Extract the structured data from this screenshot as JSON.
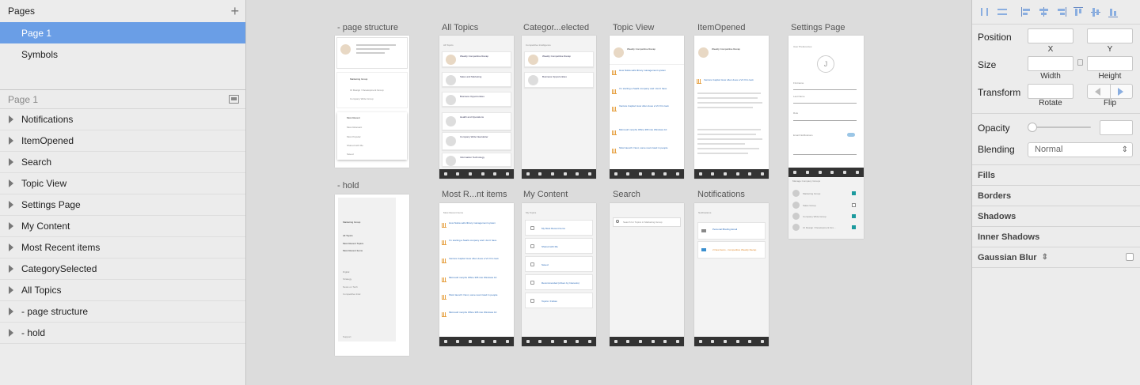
{
  "left_panel": {
    "pages_title": "Pages",
    "add_icon": "plus-icon",
    "pages": [
      {
        "label": "Page 1",
        "selected": true
      },
      {
        "label": "Symbols",
        "selected": false
      }
    ],
    "layers_title": "Page 1",
    "layers": [
      "Notifications",
      "ItemOpened",
      "Search",
      "Topic View",
      "Settings Page",
      "My Content",
      "Most Recent items",
      "CategorySelected",
      "All Topics",
      "- page structure",
      "- hold"
    ]
  },
  "canvas": {
    "artboards": {
      "page_structure": "- page structure",
      "hold": "- hold",
      "all_topics": "All Topics",
      "category": "Categor...elected",
      "topic_view": "Topic View",
      "item_opened": "ItemOpened",
      "settings": "Settings Page",
      "most_recent": "Most R...nt items",
      "my_content": "My Content",
      "search": "Search",
      "notifications": "Notifications"
    },
    "mini": {
      "structure_menu": [
        "Marketing Group",
        "UI Design / Development Group",
        "Company Wide Group"
      ],
      "structure_filters": [
        "Most Recent",
        "Most Relevant",
        "Most Popular",
        "Shared with Me",
        "Saved"
      ],
      "hold_group": "Marketing Group",
      "hold_links": [
        "All Topics",
        "Most Recent Topics",
        "Most Recent Items"
      ],
      "hold_categories": [
        "Digital",
        "Strategy",
        "News on Tech",
        "Competitive Intel"
      ],
      "hold_footer": "Support",
      "all_topics_header": "All Topics",
      "all_topics_items": [
        "Weekly Competitive Recap",
        "Sales and Marketing",
        "Business Opportunities",
        "Health and Operations",
        "Company Wide Newsletter",
        "Information Technology"
      ],
      "all_topics_letters": [
        "S",
        "B",
        "H",
        "C",
        "I"
      ],
      "category_header": "Competitive Intelligence",
      "category_items": [
        "Weekly Competitive Recap",
        "Business Opportunities"
      ],
      "topic_view_title": "Weekly Competitive Recap",
      "topic_view_items": [
        "How Nokia sells library management system",
        "I'm starting a SaaS company and I don't have",
        "Venture Capital: How often does a VC firm look",
        "Microsoft morphs Office 365 into Windows 10",
        "Short launch: Next, some real crowd in people"
      ],
      "item_opened_title": "Weekly Competitive Recap",
      "item_opened_link": "Venture Capital: How often does a VC firm look",
      "settings_header": "User Preferences",
      "settings_avatar": "J",
      "settings_fields": [
        "Firstname",
        "Last Name",
        "Role",
        "Email Notifications"
      ],
      "settings_groups_header": "Manage Company Groups",
      "settings_groups": [
        {
          "name": "Marketing Group",
          "checked": true
        },
        {
          "name": "Sales Group",
          "checked": false
        },
        {
          "name": "Company Wide Group",
          "checked": true
        },
        {
          "name": "UI Design / Development Gro...",
          "checked": true
        }
      ],
      "most_recent_header": "Most Recent Items",
      "most_recent_items": [
        "How Nokia sells library management system",
        "I'm starting a SaaS company and I don't have",
        "Venture Capital: How often does a VC firm look",
        "Microsoft morphs Office 365 into Windows 10",
        "Short launch: Next, some real crowd in people",
        "Microsoft morphs Office 365 into Windows 10"
      ],
      "my_content_header": "My Topics",
      "my_content_links": [
        "My Most Recent Items",
        "Shared with Me",
        "Saved",
        "Recommended (driven by Interests)",
        "Topics I Follow"
      ],
      "search_placeholder": "Search for Topics in Marketing Group",
      "notifications_header": "Notifications",
      "notifications_items": [
        "Personal Briefing Email",
        "2 New Items - Competitive Weekly Recap"
      ]
    }
  },
  "right_panel": {
    "position_label": "Position",
    "x_label": "X",
    "y_label": "Y",
    "size_label": "Size",
    "width_label": "Width",
    "height_label": "Height",
    "transform_label": "Transform",
    "rotate_label": "Rotate",
    "flip_label": "Flip",
    "opacity_label": "Opacity",
    "blending_label": "Blending",
    "blending_value": "Normal",
    "sections": [
      "Fills",
      "Borders",
      "Shadows",
      "Inner Shadows",
      "Gaussian Blur"
    ],
    "accent": "#6a9ee6"
  }
}
